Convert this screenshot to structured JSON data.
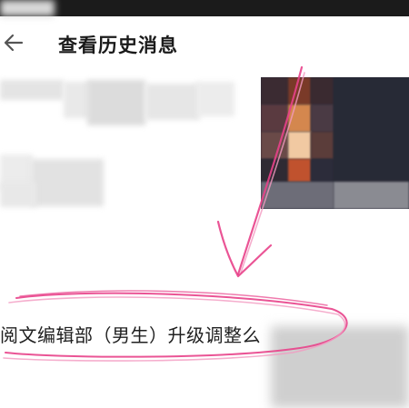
{
  "header": {
    "title": "查看历史消息",
    "back_icon": "arrow-left-icon"
  },
  "message": {
    "text": "阅文编辑部（男生）升级调整么"
  },
  "colors": {
    "status_bar": "#1b1b1b",
    "annotation": "#e8418a",
    "text": "#1a1a1a"
  }
}
